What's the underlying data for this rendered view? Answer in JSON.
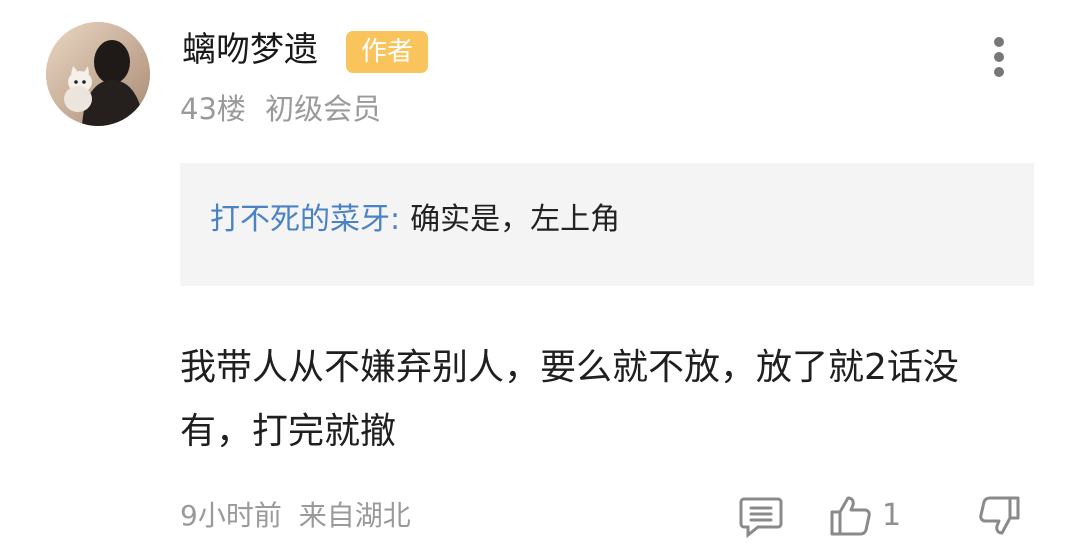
{
  "comment": {
    "username": "螭吻梦遗",
    "badge": "作者",
    "floor": "43楼",
    "level": "初级会员",
    "quote": {
      "author": "打不死的菜牙",
      "colon": ":",
      "text": "确实是，左上角"
    },
    "body": "我带人从不嫌弃别人，要么就不放，放了就2话没有，打完就撤",
    "time": "9小时前",
    "location": "来自湖北",
    "like_count": "1"
  },
  "colors": {
    "badge": "#f9c45c",
    "quote_author": "#4b82c4",
    "quote_background": "#f4f4f4",
    "meta_text": "#9a9a9a"
  },
  "icons": {
    "more": "more-vertical-icon",
    "reply": "reply-comment-icon",
    "like": "thumbs-up-icon",
    "dislike": "thumbs-down-icon"
  }
}
